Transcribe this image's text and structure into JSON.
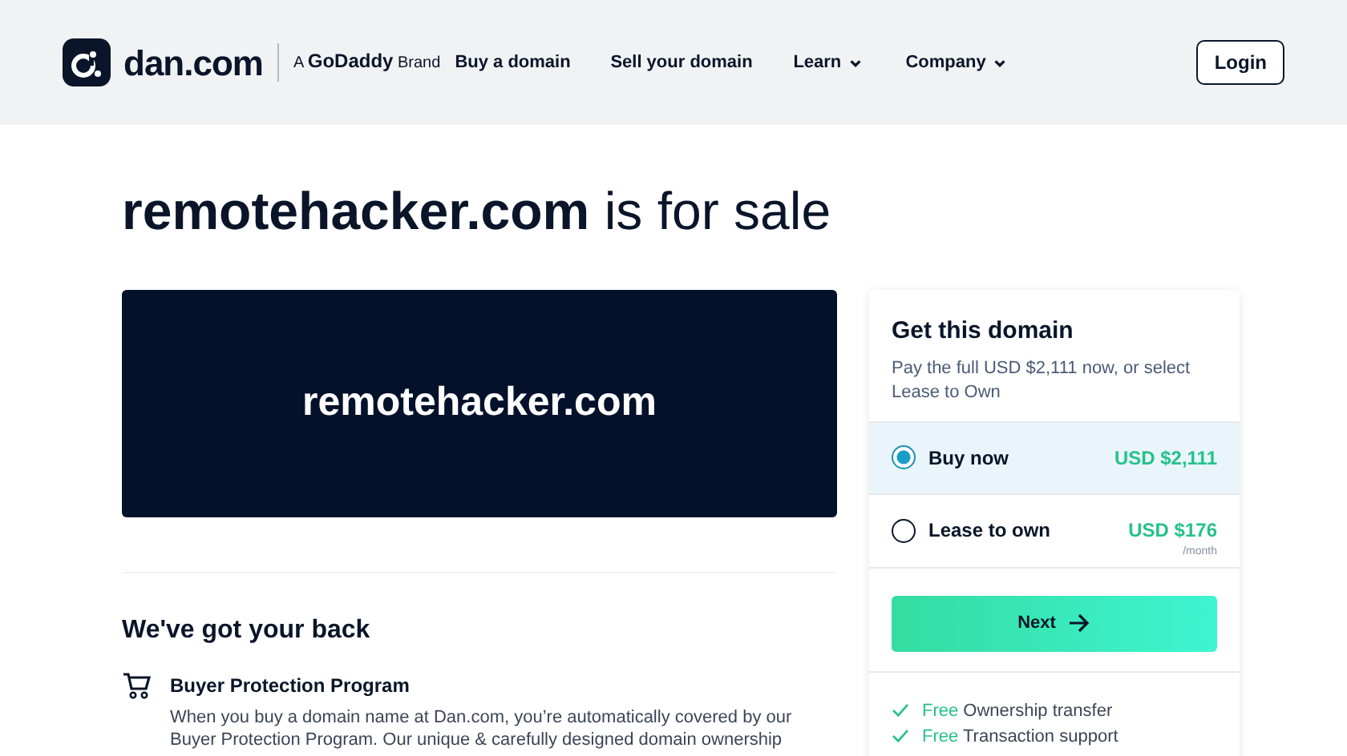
{
  "header": {
    "logo": "dan.com",
    "brand": "A **GoDaddy** Brand",
    "nav": [
      {
        "label": "Buy a domain",
        "kind": "link"
      },
      {
        "label": "Sell your domain",
        "kind": "link"
      },
      {
        "label": "Learn",
        "kind": "dropdown"
      },
      {
        "label": "Company",
        "kind": "dropdown"
      }
    ],
    "login": "Login"
  },
  "headline": "**remotehacker.com** is for sale",
  "banner": {
    "domain": "remotehacker.com"
  },
  "protection": {
    "heading": "We've got your back",
    "items": [
      {
        "title": "Buyer Protection Program",
        "text": "When you buy a domain name at Dan.com, you’re automatically covered by our Buyer Protection Program. Our unique & carefully designed domain ownership"
      }
    ]
  },
  "purchase": {
    "title": "Get this domain",
    "subtitle": "Pay the full USD $2,111 now, or select Lease to Own",
    "options": [
      {
        "label": "Buy now",
        "price": "USD $2,111",
        "selected": true
      },
      {
        "label": "Lease to own",
        "price": "USD $176",
        "period": "/month",
        "selected": false
      }
    ],
    "next": "Next",
    "perks": [
      {
        "tag": "Free",
        "text": "Ownership transfer"
      },
      {
        "tag": "Free",
        "text": "Transaction support"
      }
    ]
  }
}
